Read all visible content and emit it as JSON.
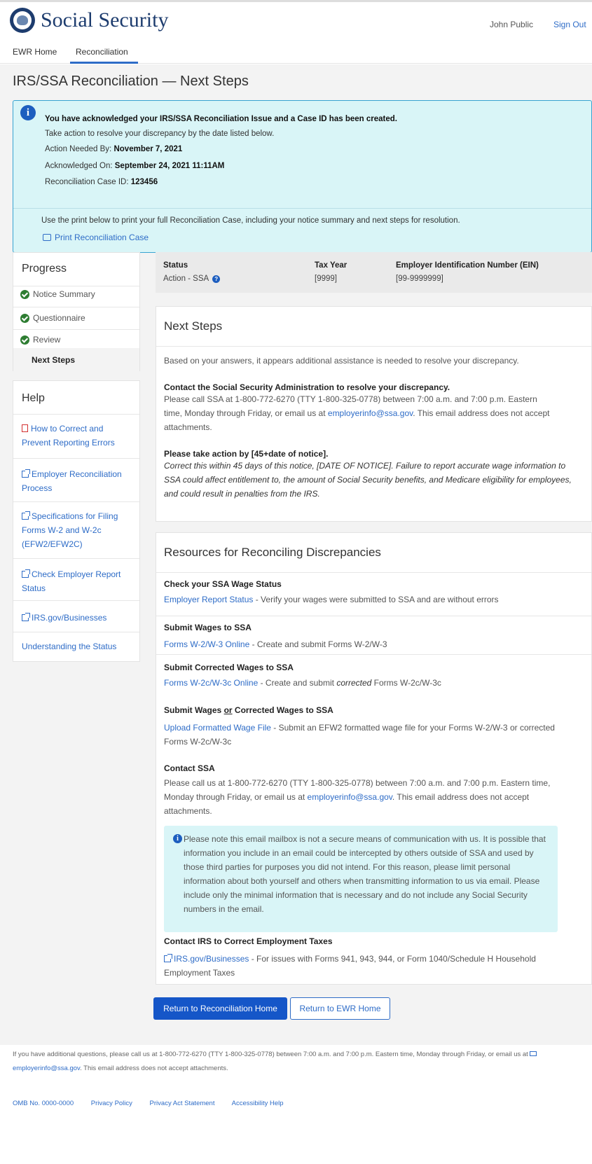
{
  "header": {
    "logo_text": "Social Security",
    "user_name": "John Public",
    "sign_out": "Sign Out"
  },
  "nav": {
    "home": "EWR Home",
    "reconciliation": "Reconciliation"
  },
  "page_title": "IRS/SSA Reconciliation — Next Steps",
  "alert": {
    "title": "You have acknowledged your IRS/SSA Reconciliation Issue and a Case ID has been created.",
    "intro": "Take action to resolve your discrepancy by the date listed below.",
    "action_label": "Action Needed By:",
    "action_value": "November 7, 2021",
    "ack_label": "Acknowledged On:",
    "ack_value": "September 24, 2021 11:11AM",
    "case_label": "Reconciliation Case ID:",
    "case_value": "123456",
    "print_text": "Use the print below to print your full Reconciliation Case, including your notice summary and next steps for resolution.",
    "print_link": "Print Reconciliation Case"
  },
  "progress": {
    "title": "Progress",
    "items": [
      "Notice Summary",
      "Questionnaire",
      "Review"
    ],
    "active": "Next Steps"
  },
  "help": {
    "title": "Help",
    "links": [
      "How to Correct and Prevent Reporting Errors",
      "Employer Reconciliation Process",
      "Specifications for Filing Forms W-2 and W-2c (EFW2/EFW2C)",
      "Check Employer Report Status",
      "IRS.gov/Businesses",
      "Understanding the Status"
    ]
  },
  "status": {
    "status_label": "Status",
    "status_value": "Action - SSA",
    "year_label": "Tax Year",
    "year_value": "[9999]",
    "ein_label": "Employer Identification Number (EIN)",
    "ein_value": "[99-9999999]"
  },
  "next_steps": {
    "title": "Next Steps",
    "intro": "Based on your answers, it appears additional assistance is needed to resolve your discrepancy.",
    "contact_heading": "Contact the Social Security Administration to resolve your discrepancy.",
    "contact_text_1": "Please call SSA at 1-800-772-6270 (TTY 1-800-325-0778) between 7:00 a.m. and 7:00 p.m. Eastern time, Monday through Friday, or email us at ",
    "contact_email": "employerinfo@ssa.gov",
    "contact_text_2": ". This email address does not accept attachments.",
    "action_heading": "Please take action by [45+date of notice].",
    "action_text": "Correct this within 45 days of this notice, [DATE OF NOTICE].  Failure to report accurate wage information to SSA could affect entitlement to, the amount of Social Security benefits, and Medicare eligibility for employees, and could result in penalties from the IRS."
  },
  "resources": {
    "title": "Resources for Reconciling Discrepancies",
    "check_heading": "Check your SSA Wage Status",
    "check_link": "Employer Report Status",
    "check_text": " - Verify your wages were submitted to SSA and are without errors",
    "submit_heading": "Submit Wages to SSA",
    "submit_link": "Forms  W-2/W-3 Online",
    "submit_text": " - Create and submit Forms W-2/W-3",
    "corrected_heading": "Submit Corrected Wages to SSA",
    "corrected_link": "Forms  W-2c/W-3c Online",
    "corrected_text_1": " - Create and submit ",
    "corrected_text_em": "corrected",
    "corrected_text_2": " Forms W-2c/W-3c",
    "either_heading_1": "Submit Wages ",
    "either_heading_or": "or",
    "either_heading_2": " Corrected Wages to SSA",
    "either_link": "Upload Formatted Wage File",
    "either_text": " - Submit an EFW2 formatted wage file for your Forms W-2/W-3 or corrected Forms W-2c/W-3c",
    "contact_heading": "Contact SSA",
    "contact_text_1": "Please call us at 1-800-772-6270 (TTY 1-800-325-0778) between 7:00 a.m. and 7:00 p.m. Eastern time, Monday through Friday, or email us at ",
    "contact_email": "employerinfo@ssa.gov",
    "contact_text_2": ". This email address does not accept attachments.",
    "note": "Please note this email mailbox is not a secure means of communication with us. It is possible that information you include in an email could be intercepted by others outside of SSA and used by those third parties for purposes you did not intend. For this reason, please limit personal information about both yourself and others when transmitting information to us via email.  Please include only the minimal information that is necessary and do not include any Social Security numbers in the email.",
    "irs_heading": "Contact IRS to Correct Employment Taxes",
    "irs_link": "IRS.gov/Businesses",
    "irs_text": " - For issues with Forms 941, 943, 944, or Form 1040/Schedule H Household Employment Taxes"
  },
  "buttons": {
    "primary": "Return to Reconciliation Home",
    "secondary": "Return to EWR Home"
  },
  "footer": {
    "text_1": "If you have additional questions, please call us at 1-800-772-6270 (TTY 1-800-325-0778) between 7:00 a.m. and 7:00 p.m. Eastern time, Monday through Friday, or email us at ",
    "email": "employerinfo@ssa.gov",
    "text_2": ". This email address does not accept attachments.",
    "links": [
      "OMB No. 0000-0000",
      "Privacy Policy",
      "Privacy Act Statement",
      "Accessibility Help"
    ]
  }
}
